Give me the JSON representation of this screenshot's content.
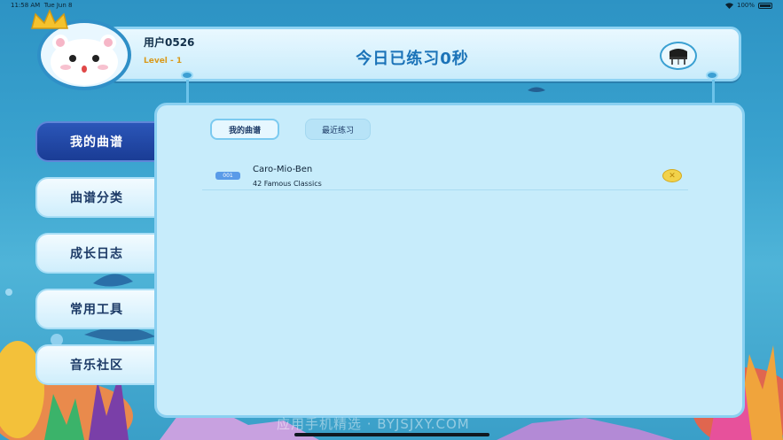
{
  "status_bar": {
    "time": "11:58 AM",
    "date": "Tue Jun 8",
    "battery": "100%"
  },
  "header": {
    "username": "用户0526",
    "level": "Level - 1",
    "practice_text": "今日已练习0秒"
  },
  "sidebar": {
    "items": [
      {
        "label": "我的曲谱",
        "active": true
      },
      {
        "label": "曲谱分类",
        "active": false
      },
      {
        "label": "成长日志",
        "active": false
      },
      {
        "label": "常用工具",
        "active": false
      },
      {
        "label": "音乐社区",
        "active": false
      }
    ]
  },
  "tabs": [
    {
      "label": "我的曲谱",
      "active": true
    },
    {
      "label": "最近练习",
      "active": false
    }
  ],
  "songs": [
    {
      "number": "001",
      "title": "Caro-Mio-Ben",
      "collection": "42 Famous Classics"
    }
  ],
  "watermark": "应用手机精选 · BYJSJXY.COM",
  "colors": {
    "accent": "#1b73b8",
    "active_nav": "#1a3c95",
    "level": "#d99a1c",
    "badge": "#5a9be8"
  },
  "icons": {
    "avatar": "hamster-avatar-icon",
    "crown": "crown-icon",
    "piano": "piano-icon",
    "remove": "close-icon"
  }
}
